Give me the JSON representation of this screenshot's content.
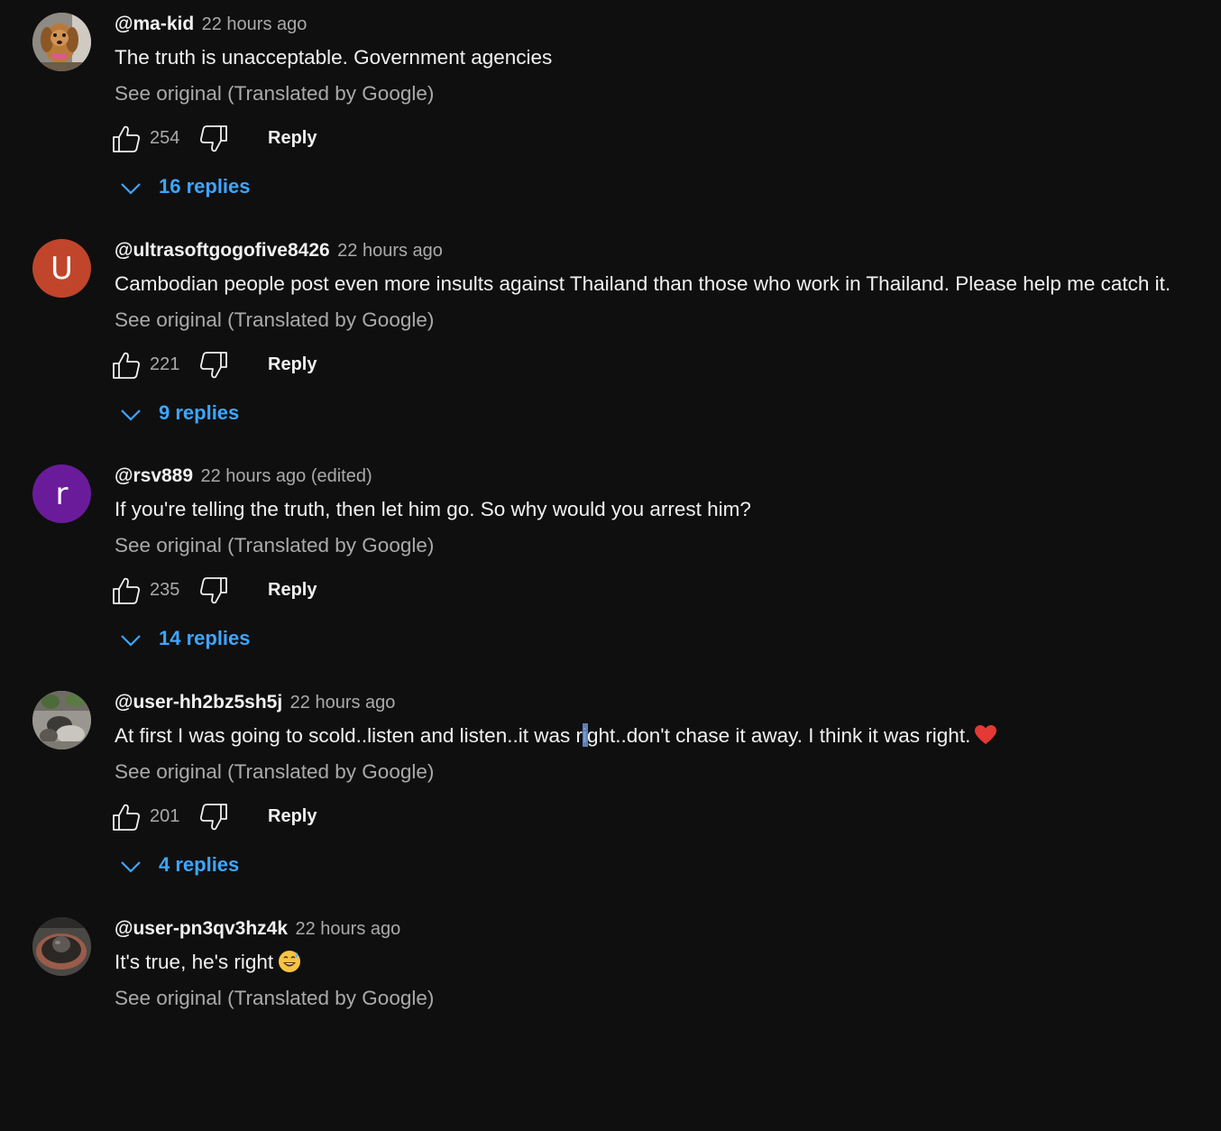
{
  "comments": [
    {
      "handle": "@ma-kid",
      "time": "22 hours ago",
      "text": "The truth is unacceptable. Government agencies",
      "see_original": "See original (Translated by Google)",
      "likes": "254",
      "reply_label": "Reply",
      "replies": "16 replies",
      "avatar": {
        "type": "photo",
        "icon": "dog-photo-avatar"
      }
    },
    {
      "handle": "@ultrasoftgogofive8426",
      "time": "22 hours ago",
      "text": "Cambodian people post even more insults against Thailand than those who work in Thailand. Please help me catch it.",
      "see_original": "See original (Translated by Google)",
      "likes": "221",
      "reply_label": "Reply",
      "replies": "9 replies",
      "avatar": {
        "type": "letter",
        "letter": "U",
        "color": "#c0452b"
      }
    },
    {
      "handle": "@rsv889",
      "time": "22 hours ago (edited)",
      "text": "If you're telling the truth, then let him go. So why would you arrest him?",
      "see_original": "See original (Translated by Google)",
      "likes": "235",
      "reply_label": "Reply",
      "replies": "14 replies",
      "avatar": {
        "type": "letter",
        "letter": "r",
        "color": "#6a1b9a"
      }
    },
    {
      "handle": "@user-hh2bz5sh5j",
      "time": "22 hours ago",
      "text_before_caret": "At first I was going to scold..listen and listen..it was r",
      "text_after_caret": "ight..don't chase it away. I think it was right.",
      "emoji": "heart-emoji",
      "see_original": "See original (Translated by Google)",
      "likes": "201",
      "reply_label": "Reply",
      "replies": "4 replies",
      "avatar": {
        "type": "photo",
        "icon": "person-photo-avatar"
      }
    },
    {
      "handle": "@user-pn3qv3hz4k",
      "time": "22 hours ago",
      "text": "It's true, he's right",
      "emoji": "grinning-sweat-emoji",
      "see_original": "See original (Translated by Google)",
      "avatar": {
        "type": "photo",
        "icon": "bowl-photo-avatar"
      }
    }
  ],
  "colors": {
    "background": "#0f0f0f",
    "link_blue": "#3ea6ff",
    "muted_text": "#aaaaaa"
  }
}
